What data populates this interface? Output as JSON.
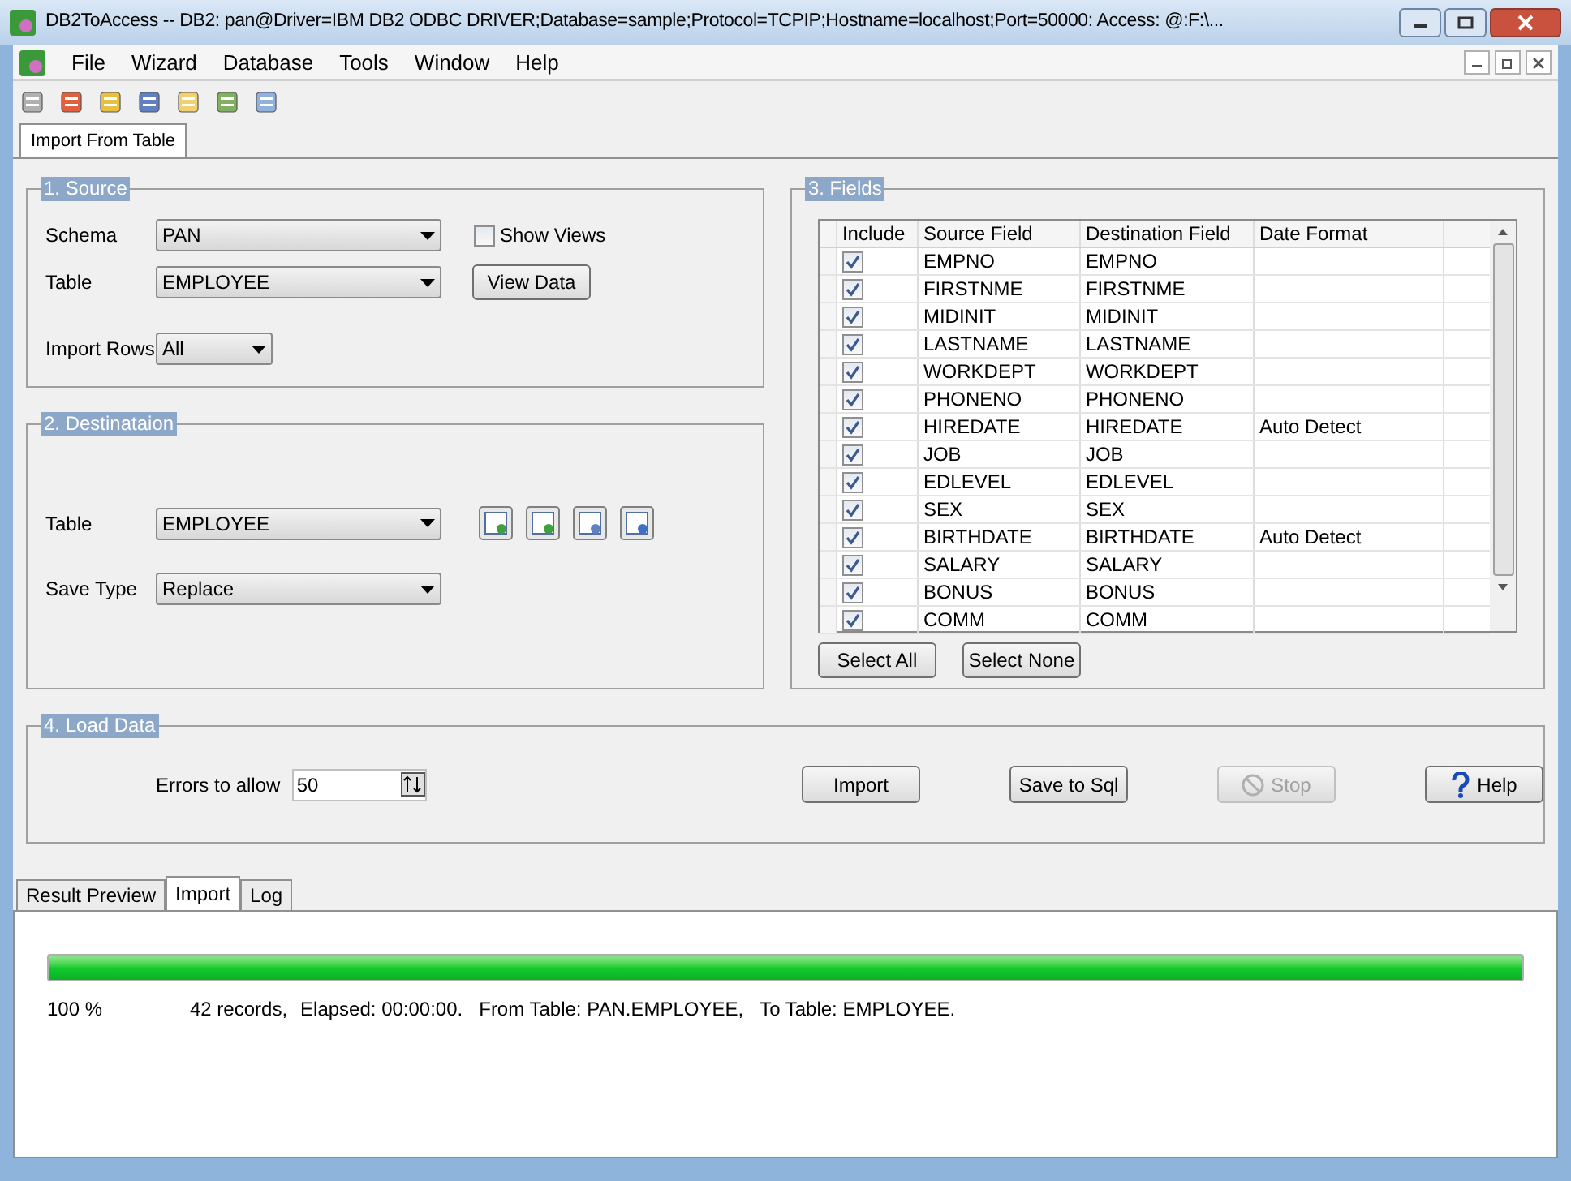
{
  "window": {
    "title": "DB2ToAccess -- DB2: pan@Driver=IBM DB2 ODBC DRIVER;Database=sample;Protocol=TCPIP;Hostname=localhost;Port=50000: Access: @:F:\\..."
  },
  "menu": [
    "File",
    "Wizard",
    "Database",
    "Tools",
    "Window",
    "Help"
  ],
  "doc_tabs": [
    {
      "label": "Import From Table",
      "selected": true
    }
  ],
  "source": {
    "title": "1. Source",
    "schema_label": "Schema",
    "schema": "PAN",
    "show_views": {
      "label": "Show Views",
      "checked": false
    },
    "table_label": "Table",
    "table": "EMPLOYEE",
    "view_data": "View Data",
    "import_rows_label": "Import Rows",
    "import_rows": "All"
  },
  "destination": {
    "title": "2. Destinataion",
    "table_label": "Table",
    "table": "EMPLOYEE",
    "save_type_label": "Save Type",
    "save_type": "Replace"
  },
  "fields": {
    "title": "3. Fields",
    "columns": [
      "Include",
      "Source Field",
      "Destination Field",
      "Date Format"
    ],
    "rows": [
      {
        "included": true,
        "source": "EMPNO",
        "destination": "EMPNO"
      },
      {
        "included": true,
        "source": "FIRSTNME",
        "destination": "FIRSTNME"
      },
      {
        "included": true,
        "source": "MIDINIT",
        "destination": "MIDINIT"
      },
      {
        "included": true,
        "source": "LASTNAME",
        "destination": "LASTNAME"
      },
      {
        "included": true,
        "source": "WORKDEPT",
        "destination": "WORKDEPT"
      },
      {
        "included": true,
        "source": "PHONENO",
        "destination": "PHONENO"
      },
      {
        "included": true,
        "source": "HIREDATE",
        "destination": "HIREDATE",
        "date_format": "Auto Detect"
      },
      {
        "included": true,
        "source": "JOB",
        "destination": "JOB"
      },
      {
        "included": true,
        "source": "EDLEVEL",
        "destination": "EDLEVEL"
      },
      {
        "included": true,
        "source": "SEX",
        "destination": "SEX"
      },
      {
        "included": true,
        "source": "BIRTHDATE",
        "destination": "BIRTHDATE",
        "date_format": "Auto Detect"
      },
      {
        "included": true,
        "source": "SALARY",
        "destination": "SALARY"
      },
      {
        "included": true,
        "source": "BONUS",
        "destination": "BONUS"
      },
      {
        "included": true,
        "source": "COMM",
        "destination": "COMM"
      }
    ],
    "select_all": "Select All",
    "select_none": "Select None"
  },
  "load": {
    "title": "4. Load Data",
    "errors_label": "Errors to allow",
    "errors_value": "50",
    "buttons": [
      {
        "kind": "plain",
        "label": "Import",
        "disabled": false
      },
      {
        "kind": "plain",
        "label": "Save to Sql",
        "disabled": false
      },
      {
        "kind": "stop",
        "label": "Stop",
        "disabled": true
      },
      {
        "kind": "help",
        "label": "Help",
        "disabled": false
      }
    ]
  },
  "result_tabs": [
    {
      "label": "Result Preview",
      "selected": false
    },
    {
      "label": "Import",
      "selected": true
    },
    {
      "label": "Log",
      "selected": false
    }
  ],
  "progress": {
    "level": 1,
    "percent": "100 %",
    "records": "42 records,",
    "elapsed": "Elapsed: 00:00:00.",
    "from": "From Table: PAN.EMPLOYEE,",
    "to": "To Table: EMPLOYEE."
  }
}
